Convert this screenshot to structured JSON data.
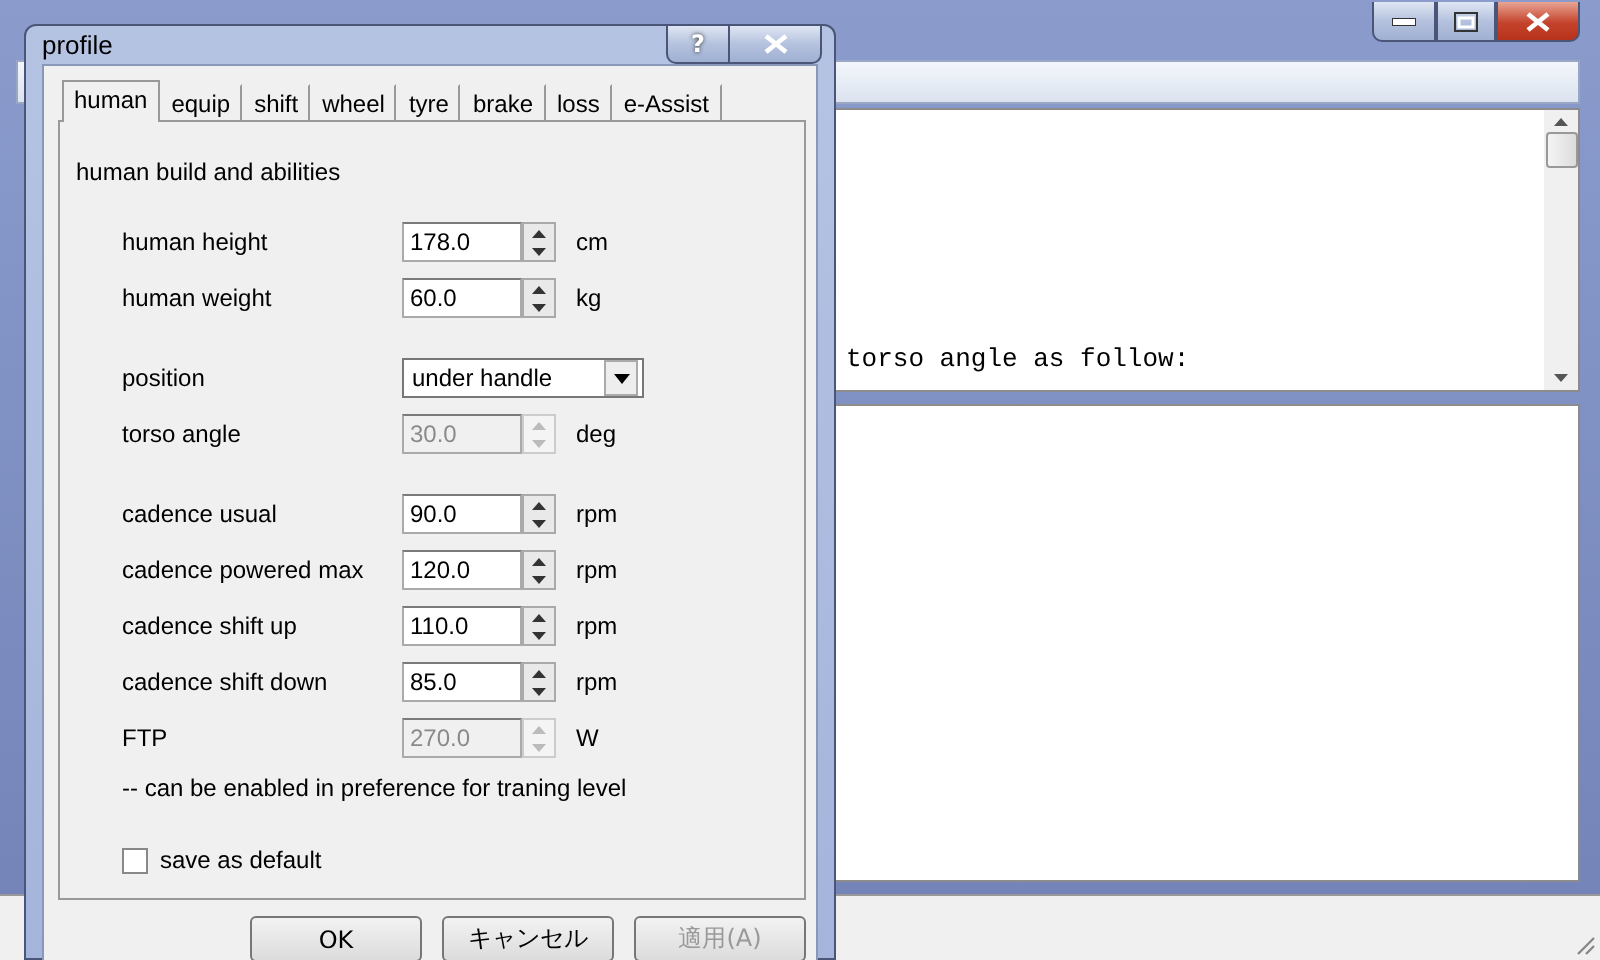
{
  "main_window": {
    "log_text": "torso angle as follow:"
  },
  "dialog": {
    "title": "profile",
    "help_button": "?",
    "tabs": [
      {
        "label": "human",
        "selected": true
      },
      {
        "label": "equip",
        "selected": false
      },
      {
        "label": "shift",
        "selected": false
      },
      {
        "label": "wheel",
        "selected": false
      },
      {
        "label": "tyre",
        "selected": false
      },
      {
        "label": "brake",
        "selected": false
      },
      {
        "label": "loss",
        "selected": false
      },
      {
        "label": "e-Assist",
        "selected": false
      }
    ],
    "section_title": "human build and abilities",
    "groups": [
      [
        {
          "kind": "spin",
          "label": "human height",
          "value": "178.0",
          "unit": "cm",
          "disabled": false
        },
        {
          "kind": "spin",
          "label": "human weight",
          "value": "60.0",
          "unit": "kg",
          "disabled": false
        }
      ],
      [
        {
          "kind": "select",
          "label": "position",
          "value": "under handle"
        },
        {
          "kind": "spin",
          "label": "torso angle",
          "value": "30.0",
          "unit": "deg",
          "disabled": true
        }
      ],
      [
        {
          "kind": "spin",
          "label": "cadence usual",
          "value": "90.0",
          "unit": "rpm",
          "disabled": false
        },
        {
          "kind": "spin",
          "label": "cadence powered max",
          "value": "120.0",
          "unit": "rpm",
          "disabled": false
        },
        {
          "kind": "spin",
          "label": "cadence shift up",
          "value": "110.0",
          "unit": "rpm",
          "disabled": false
        },
        {
          "kind": "spin",
          "label": "cadence shift down",
          "value": "85.0",
          "unit": "rpm",
          "disabled": false
        },
        {
          "kind": "spin",
          "label": "FTP",
          "value": "270.0",
          "unit": "W",
          "disabled": true
        }
      ]
    ],
    "note": "-- can be enabled in preference for traning level",
    "save_default": {
      "label": "save as default",
      "checked": false
    },
    "buttons": [
      {
        "label": "OK",
        "disabled": false
      },
      {
        "label": "キャンセル",
        "disabled": false
      },
      {
        "label": "適用(A)",
        "disabled": true
      }
    ]
  }
}
